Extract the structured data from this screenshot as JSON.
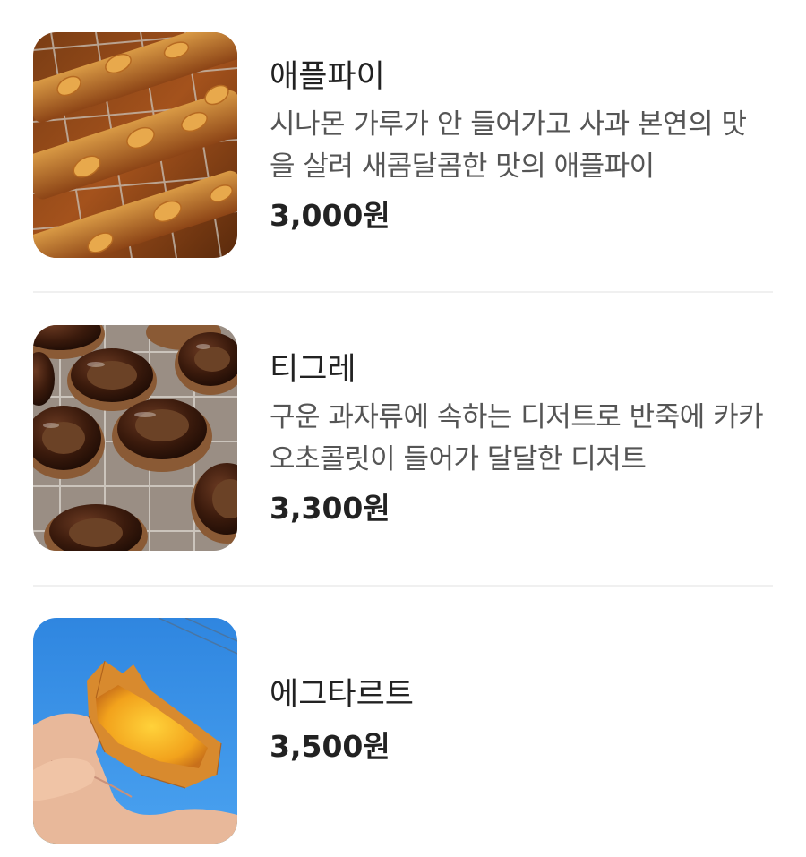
{
  "menu": {
    "items": [
      {
        "name": "애플파이",
        "description": "시나몬 가루가 안 들어가고 사과 본연의 맛을 살려 새콤달콤한 맛의 애플파이",
        "price": "3,000원",
        "image": "apple-pie-photo"
      },
      {
        "name": "티그레",
        "description": "구운 과자류에 속하는 디저트로 반죽에 카카오초콜릿이 들어가 달달한 디저트",
        "price": "3,300원",
        "image": "tigre-photo"
      },
      {
        "name": "에그타르트",
        "description": "",
        "price": "3,500원",
        "image": "egg-tart-photo"
      }
    ]
  }
}
